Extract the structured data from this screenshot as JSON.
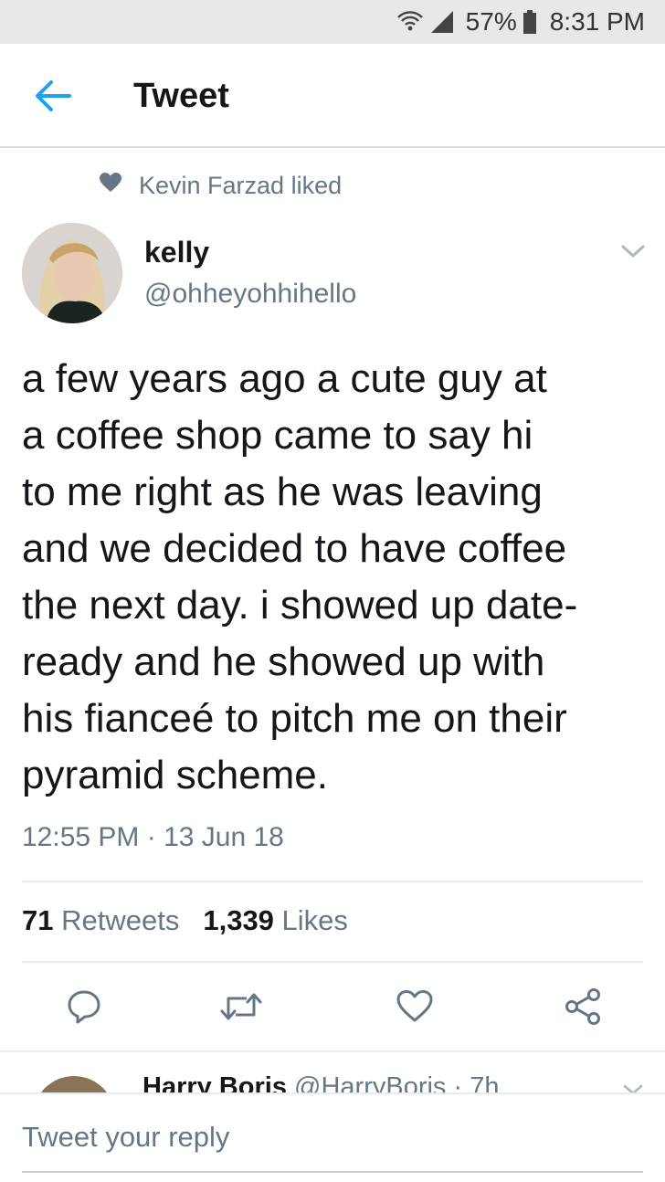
{
  "status_bar": {
    "battery": "57%",
    "time": "8:31 PM"
  },
  "header": {
    "title": "Tweet"
  },
  "social_context": {
    "text": "Kevin Farzad liked"
  },
  "tweet": {
    "author_name": "kelly",
    "author_handle": "@ohheyohhihello",
    "text_lines": [
      "a few years ago a cute guy at",
      "a coffee shop came to say hi",
      "to me right as he was leaving",
      "and we decided to have coffee",
      "the next day. i showed up date-",
      "ready and he showed up with",
      "his fianceé to pitch me on their",
      "pyramid scheme."
    ],
    "timestamp": "12:55 PM · 13 Jun 18",
    "retweets_count": "71",
    "retweets_label": "Retweets",
    "likes_count": "1,339",
    "likes_label": "Likes"
  },
  "next_reply": {
    "name": "Harry Boris",
    "handle_time": "@HarryBoris · 7h"
  },
  "composer": {
    "placeholder": "Tweet your reply"
  },
  "colors": {
    "accent": "#1da1f2",
    "secondary_text": "#657786",
    "icon_gray": "#657786"
  }
}
